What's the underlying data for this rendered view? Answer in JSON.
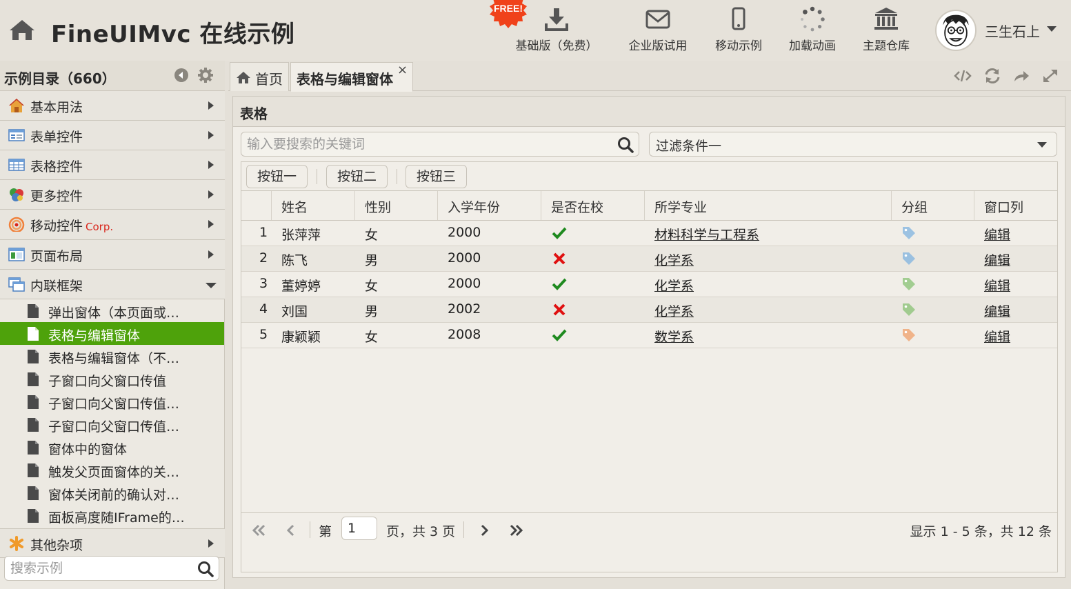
{
  "header": {
    "title": "FineUIMvc 在线示例",
    "free_badge": "FREE!",
    "buttons": [
      {
        "label": "基础版（免费）",
        "icon": "download-icon"
      },
      {
        "label": "企业版试用",
        "icon": "envelope-icon"
      },
      {
        "label": "移动示例",
        "icon": "mobile-icon"
      },
      {
        "label": "加载动画",
        "icon": "spinner-icon"
      },
      {
        "label": "主题仓库",
        "icon": "bank-icon"
      }
    ],
    "user_name": "三生石上"
  },
  "sidebar": {
    "title": "示例目录（660）",
    "accordions": [
      {
        "label": "基本用法",
        "icon": "home-icon"
      },
      {
        "label": "表单控件",
        "icon": "form-icon"
      },
      {
        "label": "表格控件",
        "icon": "table-icon"
      },
      {
        "label": "更多控件",
        "icon": "blocks-icon"
      },
      {
        "label": "移动控件",
        "corp": "Corp.",
        "icon": "rss-icon"
      },
      {
        "label": "页面布局",
        "icon": "layout-icon"
      },
      {
        "label": "内联框架",
        "icon": "windows-icon"
      }
    ],
    "tree_items": [
      "弹出窗体（本页面或…",
      "表格与编辑窗体",
      "表格与编辑窗体（不…",
      "子窗口向父窗口传值",
      "子窗口向父窗口传值…",
      "子窗口向父窗口传值…",
      "窗体中的窗体",
      "触发父页面窗体的关…",
      "窗体关闭前的确认对…",
      "面板高度随IFrame的…"
    ],
    "selected_index": 1,
    "last_accordion": {
      "label": "其他杂项",
      "icon": "asterisk-icon"
    },
    "search_placeholder": "搜索示例"
  },
  "tabs": {
    "home_label": "首页",
    "active_label": "表格与编辑窗体",
    "close_glyph": "×"
  },
  "panel": {
    "title": "表格",
    "search_placeholder": "输入要搜索的关键词",
    "filter_value": "过滤条件一",
    "buttons": [
      "按钮一",
      "按钮二",
      "按钮三"
    ],
    "columns": [
      "姓名",
      "性别",
      "入学年份",
      "是否在校",
      "所学专业",
      "分组",
      "窗口列"
    ],
    "rows": [
      {
        "idx": "1",
        "name": "张萍萍",
        "gender": "女",
        "year": "2000",
        "at_school": true,
        "major": "材料科学与工程系",
        "group_color": "#7fb3e0",
        "action": "编辑"
      },
      {
        "idx": "2",
        "name": "陈飞",
        "gender": "男",
        "year": "2000",
        "at_school": false,
        "major": "化学系",
        "group_color": "#7fb3e0",
        "action": "编辑"
      },
      {
        "idx": "3",
        "name": "董婷婷",
        "gender": "女",
        "year": "2000",
        "at_school": true,
        "major": "化学系",
        "group_color": "#8fc47a",
        "action": "编辑"
      },
      {
        "idx": "4",
        "name": "刘国",
        "gender": "男",
        "year": "2002",
        "at_school": false,
        "major": "化学系",
        "group_color": "#8fc47a",
        "action": "编辑"
      },
      {
        "idx": "5",
        "name": "康颖颖",
        "gender": "女",
        "year": "2008",
        "at_school": true,
        "major": "数学系",
        "group_color": "#f0a878",
        "action": "编辑"
      }
    ],
    "pager": {
      "page_prefix": "第",
      "page_value": "1",
      "page_suffix": "页，共 3 页",
      "summary": "显示 1 - 5 条，共 12 条"
    }
  },
  "colors": {
    "selected": "#4ea20b",
    "check": "#1f8a1f",
    "cross": "#e01010"
  }
}
